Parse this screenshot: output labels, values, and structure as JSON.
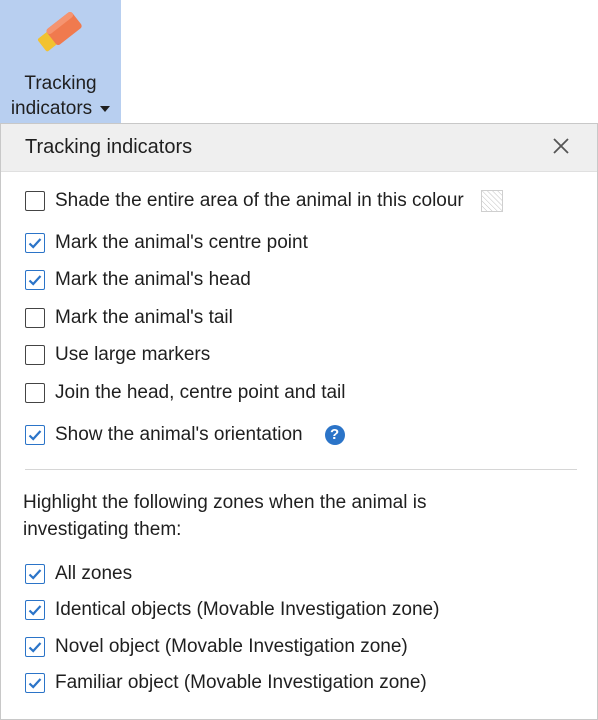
{
  "ribbon": {
    "label_line1": "Tracking",
    "label_line2": "indicators",
    "icon": "eraser-icon",
    "active_bg": "#b8cff0"
  },
  "panel": {
    "title": "Tracking indicators",
    "close_icon": "close-icon",
    "options": [
      {
        "label": "Shade the entire area of the animal in this colour",
        "checked": false
      },
      {
        "label": "Mark the animal's centre point",
        "checked": true
      },
      {
        "label": "Mark the animal's head",
        "checked": true
      },
      {
        "label": "Mark the animal's tail",
        "checked": false
      },
      {
        "label": "Use large markers",
        "checked": false
      },
      {
        "label": "Join the head, centre point and tail",
        "checked": false
      },
      {
        "label": "Show the animal's orientation",
        "checked": true
      }
    ],
    "help_symbol": "?",
    "zones_intro_line1": "Highlight the following zones when the animal is",
    "zones_intro_line2": "investigating them:",
    "zones": [
      {
        "label": "All zones",
        "checked": true
      },
      {
        "label": "Identical objects (Movable Investigation zone)",
        "checked": true
      },
      {
        "label": "Novel object (Movable Investigation zone)",
        "checked": true
      },
      {
        "label": "Familiar object (Movable Investigation zone)",
        "checked": true
      }
    ]
  },
  "colors": {
    "accent": "#2b74c8",
    "header_bg": "#efefef"
  }
}
